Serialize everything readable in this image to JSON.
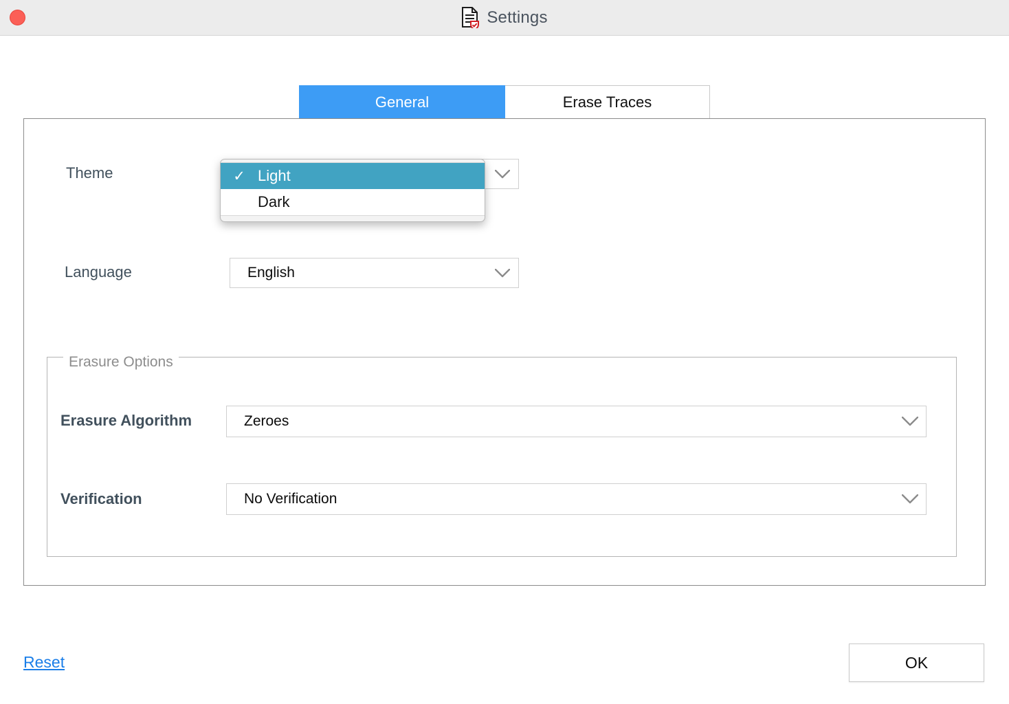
{
  "window": {
    "title": "Settings",
    "title_icon": "document-shield-icon",
    "close_button": "close-window-button",
    "titlebar_color": "#ececec",
    "close_color": "#fb5f57"
  },
  "tabs": {
    "active_index": 0,
    "accent_color": "#3d9cf5",
    "items": [
      {
        "label": "General"
      },
      {
        "label": "Erase Traces"
      }
    ]
  },
  "general": {
    "theme": {
      "label": "Theme",
      "value": "Light",
      "expanded": true,
      "highlight_color": "#41a3c2",
      "options": [
        {
          "label": "Light",
          "checked": true,
          "check_glyph": "✓"
        },
        {
          "label": "Dark",
          "checked": false,
          "check_glyph": ""
        }
      ]
    },
    "language": {
      "label": "Language",
      "value": "English"
    },
    "erasure_options": {
      "legend": "Erasure Options",
      "algorithm": {
        "label": "Erasure Algorithm",
        "value": "Zeroes"
      },
      "verification": {
        "label": "Verification",
        "value": "No Verification"
      }
    }
  },
  "footer": {
    "reset_label": "Reset",
    "reset_color": "#1a7ee8",
    "ok_label": "OK"
  }
}
